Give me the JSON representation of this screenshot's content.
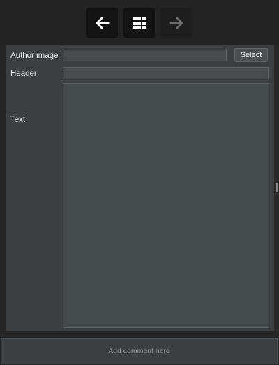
{
  "toolbar": {
    "back_icon": "arrow-left-icon",
    "grid_icon": "grid-icon",
    "forward_icon": "arrow-right-icon",
    "forward_enabled": false
  },
  "form": {
    "author_image_label": "Author image",
    "author_image_value": "",
    "select_label": "Select",
    "header_label": "Header",
    "header_value": "",
    "text_label": "Text",
    "text_value": ""
  },
  "comment": {
    "placeholder": "Add comment here"
  },
  "colors": {
    "background": "#252525",
    "panel": "#3b3f42",
    "field": "#484c4e"
  }
}
